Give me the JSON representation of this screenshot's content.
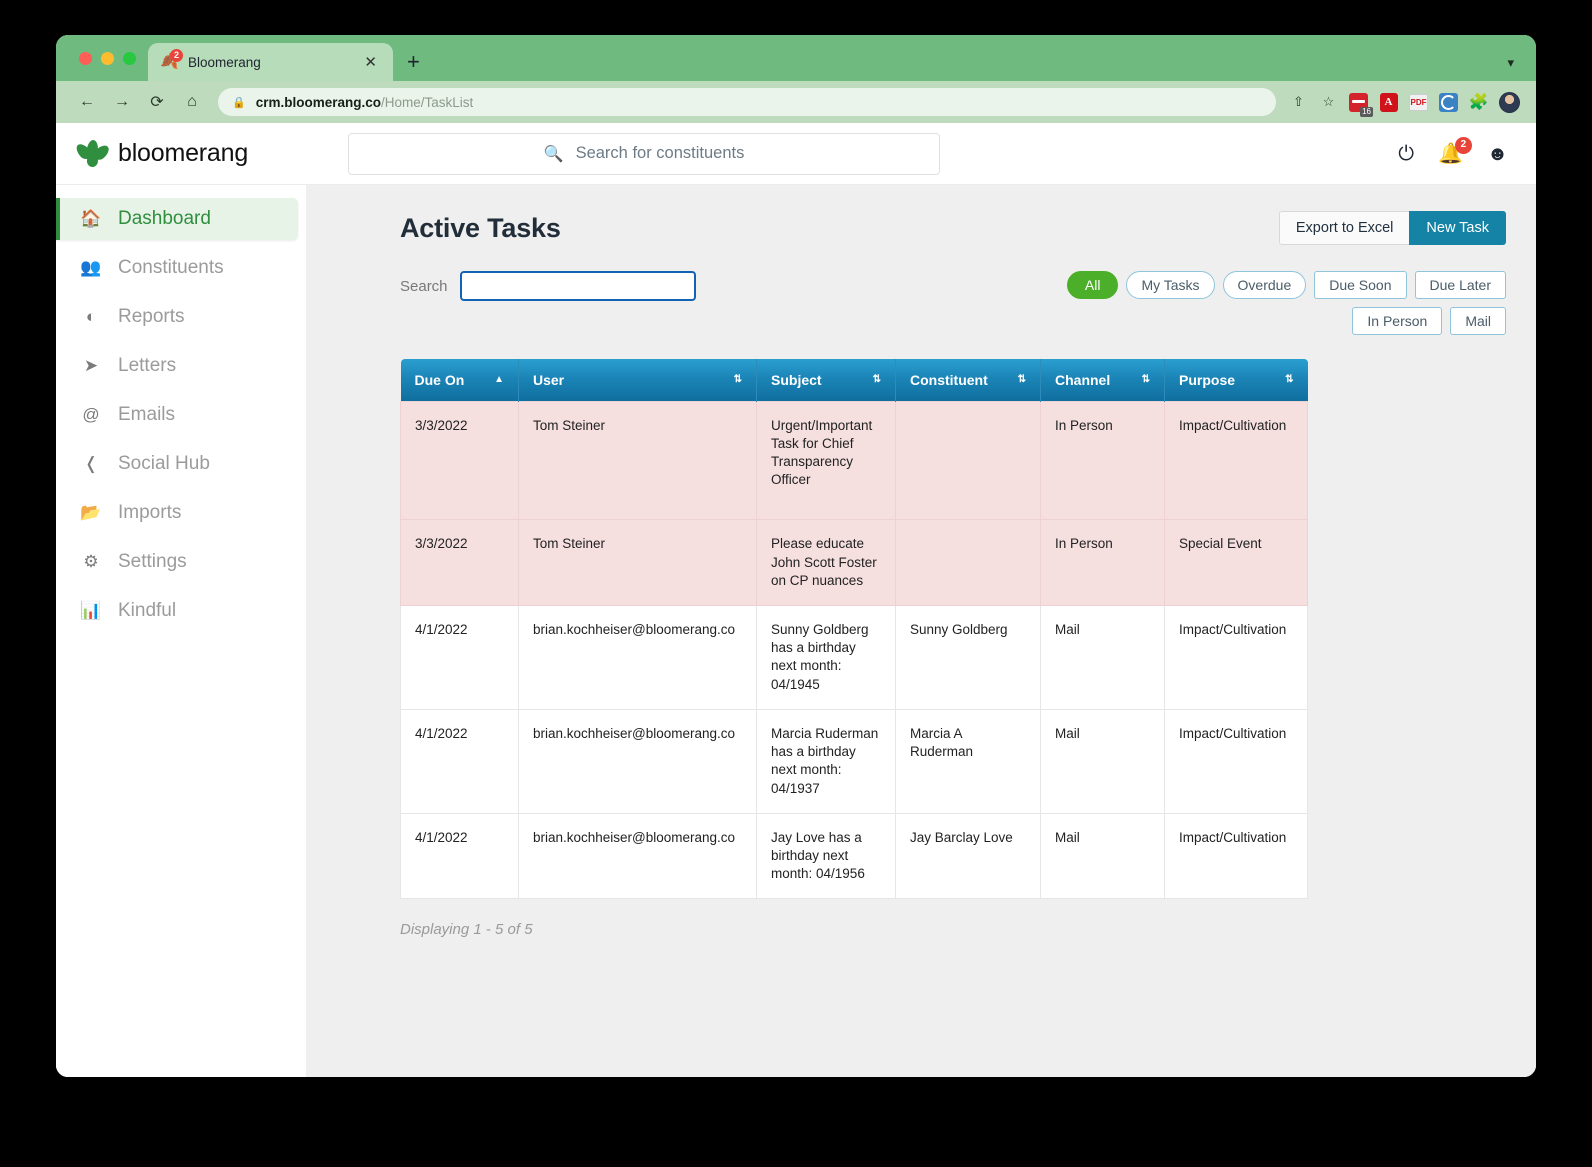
{
  "browser": {
    "tab": {
      "title": "Bloomerang",
      "favicon": "bloomerang-leaf-icon",
      "badge": "2",
      "close_label": "✕"
    },
    "new_tab_label": "+",
    "window_menu_icon": "chevron-down-icon",
    "nav": {
      "back": "←",
      "forward": "→",
      "reload": "⟳",
      "home": "⌂"
    },
    "omnibox": {
      "lock_icon": "lock-icon",
      "url_domain": "crm.bloomerang.co",
      "url_path": "/Home/TaskList"
    },
    "toolbar_icons": [
      "share-icon",
      "bookmark-star-icon",
      "calendar-extension-icon",
      "adobe-pdf-extension-icon",
      "pdf-tool-extension-icon",
      "grammarly-extension-icon",
      "puzzle-extensions-icon",
      "profile-avatar"
    ],
    "calendar_badge": "16",
    "share_icon": "⇧",
    "star_icon": "☆"
  },
  "app_header": {
    "logo_text": "bloomerang",
    "search": {
      "placeholder": "Search for constituents",
      "value": "",
      "icon": "search-icon"
    },
    "help_icon": "?",
    "notifications": {
      "icon": "bell-icon",
      "count": "2"
    },
    "account_icon": "account-circle-icon"
  },
  "sidebar": {
    "items": [
      {
        "label": "Dashboard",
        "icon": "home-icon",
        "active": true
      },
      {
        "label": "Constituents",
        "icon": "people-icon",
        "active": false
      },
      {
        "label": "Reports",
        "icon": "pie-chart-icon",
        "active": false
      },
      {
        "label": "Letters",
        "icon": "paper-plane-icon",
        "active": false
      },
      {
        "label": "Emails",
        "icon": "at-sign-icon",
        "active": false
      },
      {
        "label": "Social Hub",
        "icon": "share-nodes-icon",
        "active": false
      },
      {
        "label": "Imports",
        "icon": "folder-upload-icon",
        "active": false
      },
      {
        "label": "Settings",
        "icon": "gear-icon",
        "active": false
      },
      {
        "label": "Kindful",
        "icon": "bar-chart-icon",
        "active": false
      }
    ]
  },
  "main": {
    "page_title": "Active Tasks",
    "export_label": "Export to Excel",
    "new_task_label": "New Task",
    "search_label": "Search",
    "search_value": "",
    "search_placeholder": "",
    "filters_row1": [
      {
        "label": "All",
        "selected": true
      },
      {
        "label": "My Tasks",
        "selected": false
      },
      {
        "label": "Overdue",
        "selected": false
      },
      {
        "label": "Due Soon",
        "selected": false
      },
      {
        "label": "Due Later",
        "selected": false
      }
    ],
    "filters_row2": [
      {
        "label": "In Person",
        "selected": false
      },
      {
        "label": "Mail",
        "selected": false
      }
    ],
    "table": {
      "columns": [
        {
          "label": "Due On",
          "sort": "asc",
          "sort_icon": "sort-ascending-icon"
        },
        {
          "label": "User",
          "sort": "none",
          "sort_icon": "sort-icon"
        },
        {
          "label": "Subject",
          "sort": "none",
          "sort_icon": "sort-icon"
        },
        {
          "label": "Constituent",
          "sort": "none",
          "sort_icon": "sort-icon"
        },
        {
          "label": "Channel",
          "sort": "none",
          "sort_icon": "sort-icon"
        },
        {
          "label": "Purpose",
          "sort": "none",
          "sort_icon": "sort-icon"
        }
      ],
      "rows": [
        {
          "overdue": true,
          "due_on": "3/3/2022",
          "user": "Tom Steiner",
          "subject": "Urgent/Important Task for Chief Transparency Officer",
          "constituent": "",
          "channel": "In Person",
          "purpose": "Impact/Cultivation"
        },
        {
          "overdue": true,
          "due_on": "3/3/2022",
          "user": "Tom Steiner",
          "subject": "Please educate John Scott Foster on CP nuances",
          "constituent": "",
          "channel": "In Person",
          "purpose": "Special Event"
        },
        {
          "overdue": false,
          "due_on": "4/1/2022",
          "user": "brian.kochheiser@bloomerang.co",
          "subject": "Sunny Goldberg has a birthday next month: 04/1945",
          "constituent": "Sunny Goldberg",
          "channel": "Mail",
          "purpose": "Impact/Cultivation"
        },
        {
          "overdue": false,
          "due_on": "4/1/2022",
          "user": "brian.kochheiser@bloomerang.co",
          "subject": "Marcia Ruderman has a birthday next month: 04/1937",
          "constituent": "Marcia A Ruderman",
          "channel": "Mail",
          "purpose": "Impact/Cultivation"
        },
        {
          "overdue": false,
          "due_on": "4/1/2022",
          "user": "brian.kochheiser@bloomerang.co",
          "subject": "Jay Love has a birthday next month: 04/1956",
          "constituent": "Jay Barclay Love",
          "channel": "Mail",
          "purpose": "Impact/Cultivation"
        }
      ]
    },
    "displaying": "Displaying 1 - 5 of 5"
  },
  "colors": {
    "brand_green": "#2f8f3e",
    "chrome_green": "#6fba7f",
    "table_header_blue": "#1b83b6",
    "new_task_blue": "#1583a5",
    "overdue_row": "#f6dfdf",
    "selected_chip_green": "#4caf29",
    "focus_border_blue": "#1363b5",
    "page_bg": "#efefef"
  }
}
